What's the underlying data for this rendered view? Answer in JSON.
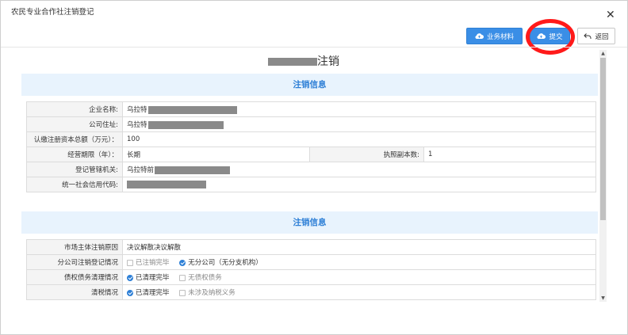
{
  "window": {
    "title": "农民专业合作社注销登记"
  },
  "toolbar": {
    "materials_label": "业务材料",
    "submit_label": "提交",
    "back_label": "返回"
  },
  "page": {
    "heading_suffix": "注销"
  },
  "basic_section": {
    "title": "注销信息",
    "rows": {
      "company_name_label": "企业名称:",
      "company_name_value": "乌拉特",
      "address_label": "公司住址:",
      "address_value": "乌拉特",
      "capital_label": "认缴注册资本总额（万元）：",
      "capital_value": "100",
      "term_label": "经营期限（年）：",
      "term_value": "长期",
      "copies_label": "执照副本数:",
      "copies_value": "1",
      "authority_label": "登记管辖机关:",
      "authority_value": "乌拉特前",
      "credit_code_label": "统一社会信用代码:"
    }
  },
  "cancel_section": {
    "title": "注销信息",
    "rows": {
      "reason_label": "市场主体注销原因",
      "reason_value": "决议解散决议解散",
      "branch_label": "分公司注销登记情况",
      "branch_opt1": "已注销完毕",
      "branch_opt2": "无分公司（无分支机构）",
      "debt_label": "债权债务清理情况",
      "debt_opt1": "已清理完毕",
      "debt_opt2": "无债权债务",
      "liquidation_label": "清税情况",
      "liquidation_opt1": "已清理完毕",
      "liquidation_opt2": "未涉及纳税义务"
    }
  },
  "colors": {
    "accent": "#3a8ee6",
    "highlight": "#ff1a1a",
    "section_bg": "#e8f3fd"
  },
  "icons": {
    "materials": "cloud-upload-icon",
    "submit": "cloud-upload-icon",
    "back": "undo-arrow-icon",
    "close": "close-icon"
  }
}
